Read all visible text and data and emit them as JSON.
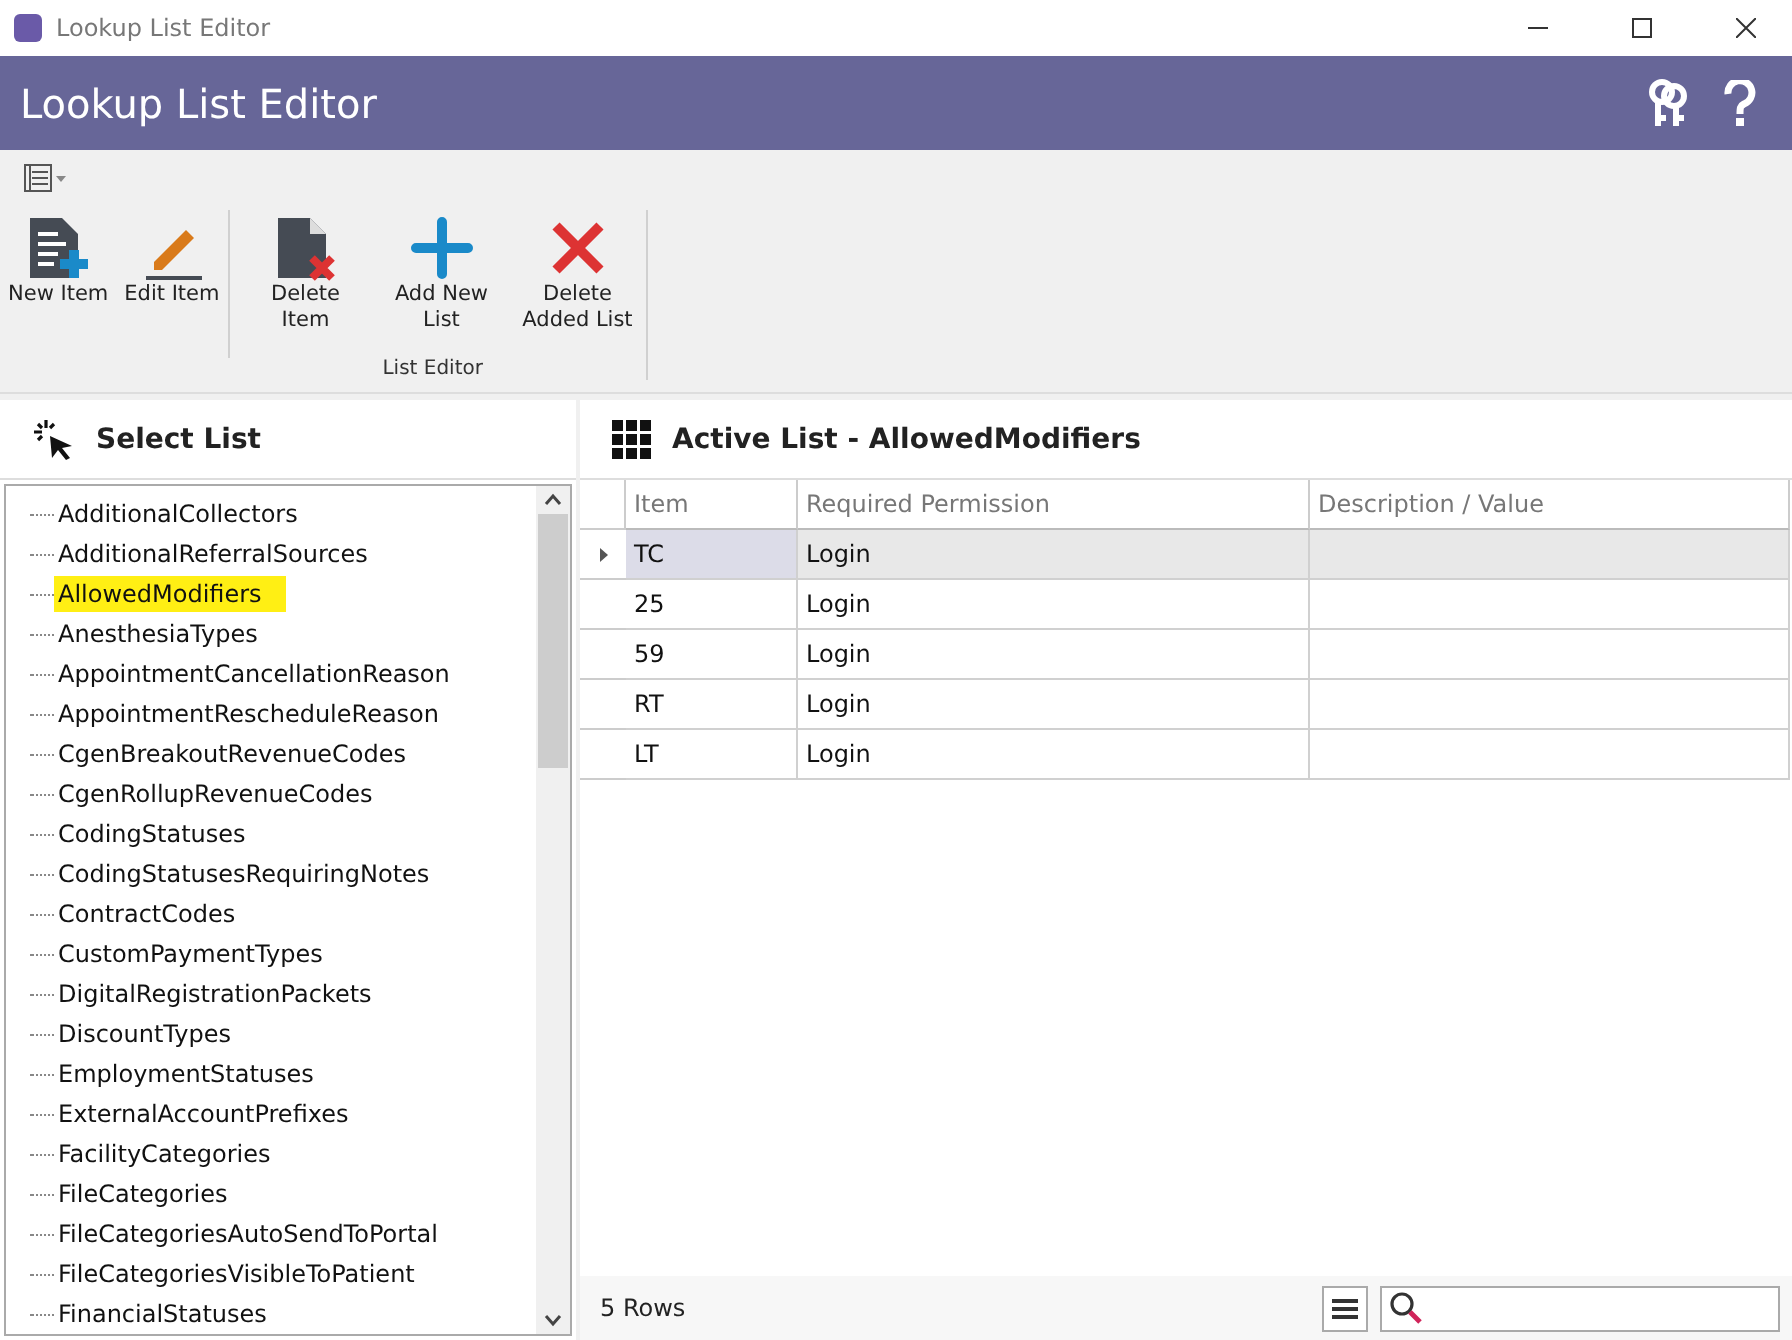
{
  "window": {
    "title": "Lookup List Editor"
  },
  "header": {
    "title": "Lookup List Editor"
  },
  "ribbon": {
    "groups": [
      {
        "label": "List Editor",
        "buttons": [
          {
            "label": "New Item",
            "kind": "new"
          },
          {
            "label": "Edit Item",
            "kind": "edit"
          },
          {
            "label": "Delete Item",
            "kind": "delete"
          },
          {
            "label": "Add New List",
            "kind": "add"
          },
          {
            "label": "Delete Added List",
            "kind": "remove"
          }
        ]
      }
    ]
  },
  "select_list": {
    "title": "Select List",
    "items": [
      {
        "label": "AdditionalCollectors",
        "selected": false
      },
      {
        "label": "AdditionalReferralSources",
        "selected": false
      },
      {
        "label": "AllowedModifiers",
        "selected": true
      },
      {
        "label": "AnesthesiaTypes",
        "selected": false
      },
      {
        "label": "AppointmentCancellationReason",
        "selected": false
      },
      {
        "label": "AppointmentRescheduleReason",
        "selected": false
      },
      {
        "label": "CgenBreakoutRevenueCodes",
        "selected": false
      },
      {
        "label": "CgenRollupRevenueCodes",
        "selected": false
      },
      {
        "label": "CodingStatuses",
        "selected": false
      },
      {
        "label": "CodingStatusesRequiringNotes",
        "selected": false
      },
      {
        "label": "ContractCodes",
        "selected": false
      },
      {
        "label": "CustomPaymentTypes",
        "selected": false
      },
      {
        "label": "DigitalRegistrationPackets",
        "selected": false
      },
      {
        "label": "DiscountTypes",
        "selected": false
      },
      {
        "label": "EmploymentStatuses",
        "selected": false
      },
      {
        "label": "ExternalAccountPrefixes",
        "selected": false
      },
      {
        "label": "FacilityCategories",
        "selected": false
      },
      {
        "label": "FileCategories",
        "selected": false
      },
      {
        "label": "FileCategoriesAutoSendToPortal",
        "selected": false
      },
      {
        "label": "FileCategoriesVisibleToPatient",
        "selected": false
      },
      {
        "label": "FinancialStatuses",
        "selected": false
      }
    ]
  },
  "active_list": {
    "title": "Active List - AllowedModifiers",
    "columns": [
      "Item",
      "Required Permission",
      "Description / Value"
    ],
    "rows": [
      {
        "cells": [
          "TC",
          "Login",
          ""
        ],
        "selected": true
      },
      {
        "cells": [
          "25",
          "Login",
          ""
        ],
        "selected": false
      },
      {
        "cells": [
          "59",
          "Login",
          ""
        ],
        "selected": false
      },
      {
        "cells": [
          "RT",
          "Login",
          ""
        ],
        "selected": false
      },
      {
        "cells": [
          "LT",
          "Login",
          ""
        ],
        "selected": false
      }
    ],
    "row_count": "5 Rows"
  }
}
